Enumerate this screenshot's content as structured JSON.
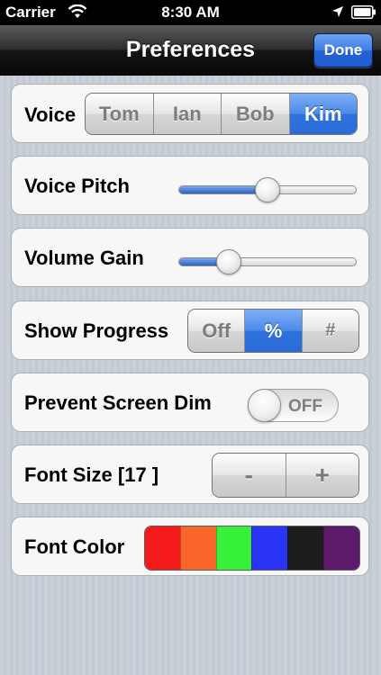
{
  "status_bar": {
    "carrier": "Carrier",
    "time": "8:30 AM",
    "icons": [
      "wifi-icon",
      "location-arrow-icon",
      "battery-icon"
    ]
  },
  "nav": {
    "title": "Preferences",
    "done_label": "Done"
  },
  "voice": {
    "label": "Voice",
    "options": [
      "Tom",
      "Ian",
      "Bob",
      "Kim"
    ],
    "selected": "Kim"
  },
  "voice_pitch": {
    "label": "Voice Pitch",
    "value": 0.5
  },
  "volume_gain": {
    "label": "Volume Gain",
    "value": 0.28
  },
  "show_progress": {
    "label": "Show Progress",
    "options": [
      "Off",
      "%",
      "#"
    ],
    "selected": "%"
  },
  "prevent_dim": {
    "label": "Prevent Screen Dim",
    "state": "OFF"
  },
  "font_size": {
    "label": "Font Size [17 ]",
    "decrease": "-",
    "increase": "+"
  },
  "font_color": {
    "label": "Font Color",
    "colors": [
      "#f41a1a",
      "#f9662a",
      "#36f03a",
      "#2a34f6",
      "#1c1c1c",
      "#5e1b6b"
    ]
  },
  "theme": {
    "accent": "#2f72de",
    "nav_bar": "#141414"
  }
}
